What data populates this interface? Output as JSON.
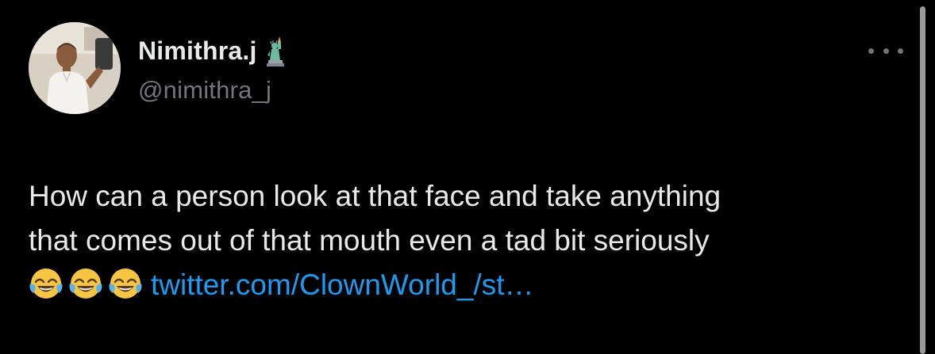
{
  "tweet": {
    "author": {
      "display_name": "Nimithra.j",
      "name_emoji": "statue-of-liberty-emoji",
      "handle": "@nimithra_j"
    },
    "text_lines": [
      "How can a person look at that face and take anything",
      "that comes out of that mouth even a tad bit seriously"
    ],
    "emojis": [
      "face-with-tears-of-joy-emoji",
      "face-with-tears-of-joy-emoji",
      "face-with-tears-of-joy-emoji"
    ],
    "link_text": "twitter.com/ClownWorld_/st…",
    "more_icon": "more-options-icon"
  },
  "colors": {
    "background": "#000000",
    "text": "#e7e9ea",
    "secondary": "#71767b",
    "link": "#1d9bf0"
  }
}
